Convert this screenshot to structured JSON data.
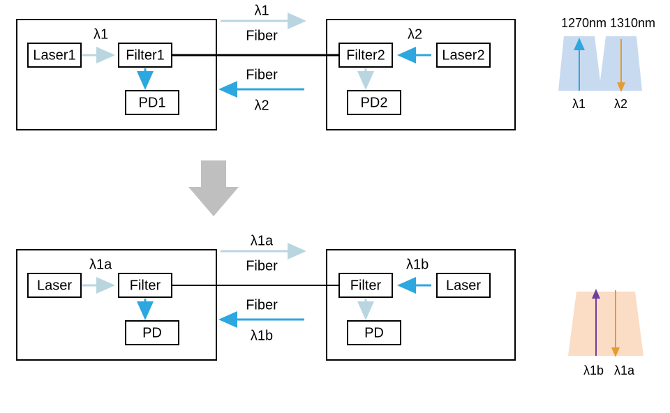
{
  "top": {
    "left": {
      "laser": "Laser1",
      "filter": "Filter1",
      "pd": "PD1",
      "lambda": "λ1"
    },
    "right": {
      "laser": "Laser2",
      "filter": "Filter2",
      "pd": "PD2",
      "lambda": "λ2"
    },
    "fiber_fwd": "Fiber",
    "fiber_rev": "Fiber",
    "lambda_fwd": "λ1",
    "lambda_rev": "λ2"
  },
  "bottom": {
    "left": {
      "laser": "Laser",
      "filter": "Filter",
      "pd": "PD",
      "lambda": "λ1a"
    },
    "right": {
      "laser": "Laser",
      "filter": "Filter",
      "pd": "PD",
      "lambda": "λ1b"
    },
    "fiber_fwd": "Fiber",
    "fiber_rev": "Fiber",
    "lambda_fwd": "λ1a",
    "lambda_rev": "λ1b"
  },
  "spectrum_top": {
    "nm1": "1270nm",
    "nm2": "1310nm",
    "l1": "λ1",
    "l2": "λ2"
  },
  "spectrum_bottom": {
    "l1": "λ1b",
    "l2": "λ1a"
  },
  "colors": {
    "lightblue": "#c8daf0",
    "orangefill": "#fbdcc4",
    "arrow_light": "#b9d6e0",
    "arrow_blue": "#2ca7df",
    "arrow_purple": "#6f3fa0",
    "arrow_orange": "#e79a2e",
    "mid_arrow": "#bfbfbf"
  }
}
